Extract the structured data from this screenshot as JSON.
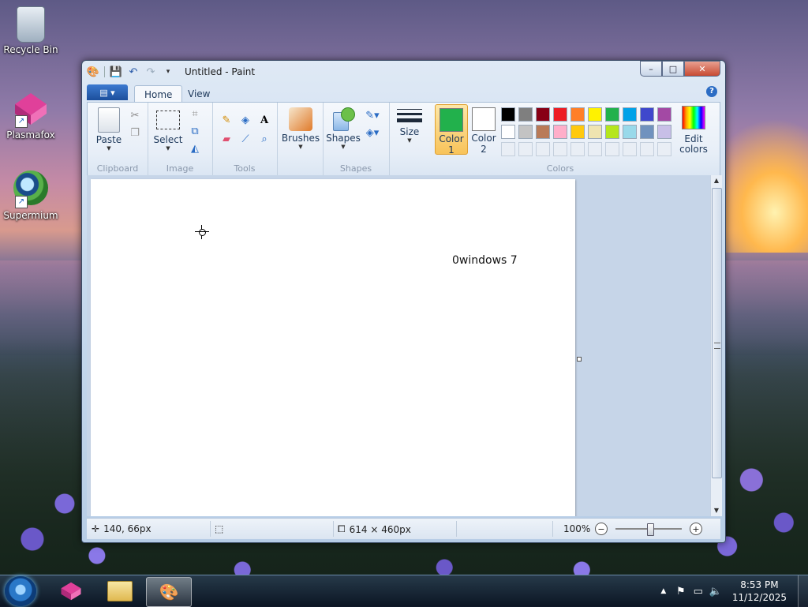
{
  "desktop": {
    "icons": [
      {
        "label": "Recycle Bin",
        "icon": "recycle-bin-icon"
      },
      {
        "label": "Plasmafox",
        "icon": "plasmafox-icon"
      },
      {
        "label": "Supermium",
        "icon": "supermium-icon"
      }
    ]
  },
  "window": {
    "title": "Untitled - Paint",
    "caption": {
      "minimize": "–",
      "maximize": "□",
      "close": "✕"
    }
  },
  "ribbon": {
    "tabs": [
      {
        "label": "Home",
        "active": true
      },
      {
        "label": "View",
        "active": false
      }
    ],
    "groups": {
      "clipboard": {
        "label": "Clipboard",
        "paste": "Paste"
      },
      "image": {
        "label": "Image",
        "select": "Select"
      },
      "tools": {
        "label": "Tools"
      },
      "brushes": {
        "label": "Brushes"
      },
      "shapes": {
        "label": "Shapes",
        "shapes_btn": "Shapes"
      },
      "size": {
        "label": "Size"
      },
      "colors": {
        "label": "Colors",
        "color1_line1": "Color",
        "color1_line2": "1",
        "color1_value": "#22b14c",
        "color2_line1": "Color",
        "color2_line2": "2",
        "color2_value": "#ffffff",
        "edit_line1": "Edit",
        "edit_line2": "colors",
        "palette_row1": [
          "#000000",
          "#7f7f7f",
          "#880015",
          "#ed1c24",
          "#ff7f27",
          "#fff200",
          "#22b14c",
          "#00a2e8",
          "#3f48cc",
          "#a349a4"
        ],
        "palette_row2": [
          "#ffffff",
          "#c3c3c3",
          "#b97a57",
          "#ffaec9",
          "#ffc90e",
          "#efe4b0",
          "#b5e61d",
          "#99d9ea",
          "#7092be",
          "#c8bfe7"
        ]
      }
    }
  },
  "canvas": {
    "text": "0windows 7"
  },
  "status": {
    "cursor_pos": "140, 66px",
    "image_size": "614 × 460px",
    "zoom": "100%"
  },
  "taskbar": {
    "time": "8:53 PM",
    "date": "11/12/2025"
  }
}
